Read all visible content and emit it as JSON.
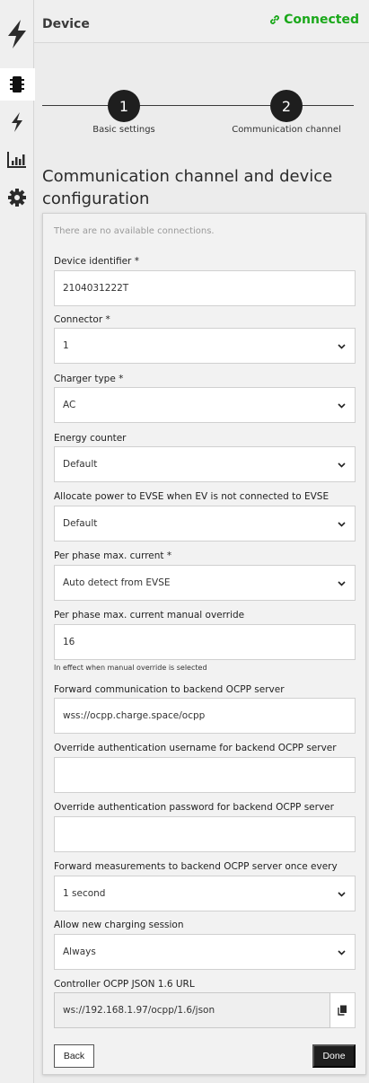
{
  "header": {
    "title": "Device",
    "status": "Connected"
  },
  "sidebar": {
    "items": [
      "device-icon",
      "charging-icon",
      "statistics-icon",
      "settings-icon"
    ]
  },
  "stepper": {
    "steps": [
      {
        "number": "1",
        "label": "Basic settings"
      },
      {
        "number": "2",
        "label": "Communication channel"
      }
    ]
  },
  "section_title": "Communication channel and device configuration",
  "form": {
    "note": "There are no available connections.",
    "device_identifier": {
      "label": "Device identifier *",
      "value": "2104031222T"
    },
    "connector": {
      "label": "Connector *",
      "value": "1"
    },
    "charger_type": {
      "label": "Charger type *",
      "value": "AC"
    },
    "energy_counter": {
      "label": "Energy counter",
      "value": "Default"
    },
    "allocate_power": {
      "label": "Allocate power to EVSE when EV is not connected to EVSE",
      "value": "Default"
    },
    "per_phase_max": {
      "label": "Per phase max. current *",
      "value": "Auto detect from EVSE"
    },
    "manual_override": {
      "label": "Per phase max. current manual override",
      "value": "16",
      "hint": "In effect when manual override is selected"
    },
    "forward_backend": {
      "label": "Forward communication to backend OCPP server",
      "value": "wss://ocpp.charge.space/ocpp"
    },
    "auth_username": {
      "label": "Override authentication username for backend OCPP server",
      "value": ""
    },
    "auth_password": {
      "label": "Override authentication password for backend OCPP server",
      "value": ""
    },
    "forward_measurements": {
      "label": "Forward measurements to backend OCPP server once every",
      "value": "1 second"
    },
    "allow_session": {
      "label": "Allow new charging session",
      "value": "Always"
    },
    "controller_url": {
      "label": "Controller OCPP JSON 1.6 URL",
      "value": "ws://192.168.1.97/ocpp/1.6/json"
    }
  },
  "buttons": {
    "back": "Back",
    "done": "Done"
  },
  "colors": {
    "connected": "#1aa81a",
    "dark": "#1e1e1e"
  }
}
